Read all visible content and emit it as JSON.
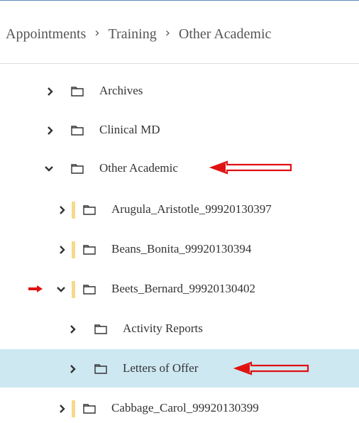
{
  "breadcrumb": {
    "items": [
      "Appointments",
      "Training",
      "Other Academic"
    ],
    "separator": "›"
  },
  "tree": {
    "items": [
      {
        "label": "Archives",
        "state": "collapsed",
        "level": 0
      },
      {
        "label": "Clinical MD",
        "state": "collapsed",
        "level": 0
      },
      {
        "label": "Other Academic",
        "state": "expanded",
        "level": 0
      },
      {
        "label": "Arugula_Aristotle_99920130397",
        "state": "collapsed",
        "level": 1
      },
      {
        "label": "Beans_Bonita_99920130394",
        "state": "collapsed",
        "level": 1
      },
      {
        "label": "Beets_Bernard_99920130402",
        "state": "expanded",
        "level": 1
      },
      {
        "label": "Activity Reports",
        "state": "collapsed",
        "level": 2
      },
      {
        "label": "Letters of Offer",
        "state": "collapsed",
        "level": 2,
        "selected": true
      },
      {
        "label": "Cabbage_Carol_99920130399",
        "state": "collapsed",
        "level": 1
      }
    ]
  },
  "colors": {
    "selected_row": "#cde8f1",
    "level_bar": "#f6d98a",
    "annotation_arrow": "#e01010",
    "top_rule": "#5b8db8"
  }
}
